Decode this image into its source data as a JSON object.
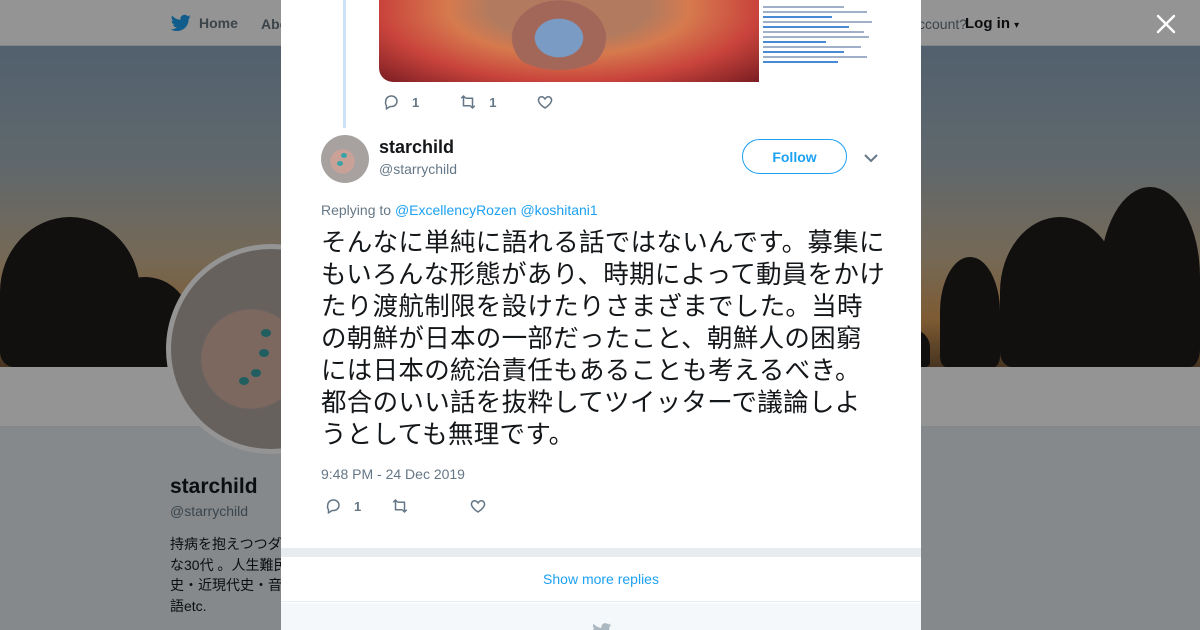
{
  "nav": {
    "home_label": "Home",
    "about_label": "Abo",
    "account_prompt": "ccount?",
    "login_label": "Log in"
  },
  "profile_bg": {
    "name": "starchild",
    "handle": "@starrychild",
    "bio_lines": [
      "持病を抱えつつダ",
      "な30代 。人生難民",
      "史・近現代史・音",
      "語etc."
    ]
  },
  "parent_tweet": {
    "reply_count": "1",
    "retweet_count": "1"
  },
  "tweet": {
    "author_name": "starchild",
    "author_handle": "@starrychild",
    "follow_label": "Follow",
    "replying_prefix": "Replying to",
    "replying_to": [
      "@ExcellencyRozen",
      "@koshitani1"
    ],
    "text": "そんなに単純に語れる話ではないんです。募集にもいろんな形態があり、時期によって動員をかけたり渡航制限を設けたりさまざまでした。当時の朝鮮が日本の一部だったこと、朝鮮人の困窮には日本の統治責任もあることも考えるべき。都合のいい話を抜粋してツイッターで議論しようとしても無理です。",
    "timestamp": "9:48 PM - 24 Dec 2019",
    "reply_count": "1"
  },
  "show_more_label": "Show more replies",
  "colors": {
    "accent": "#1da1f2",
    "muted": "#657786",
    "thread_line": "#cce2f7",
    "divider": "#e6ecf0"
  }
}
